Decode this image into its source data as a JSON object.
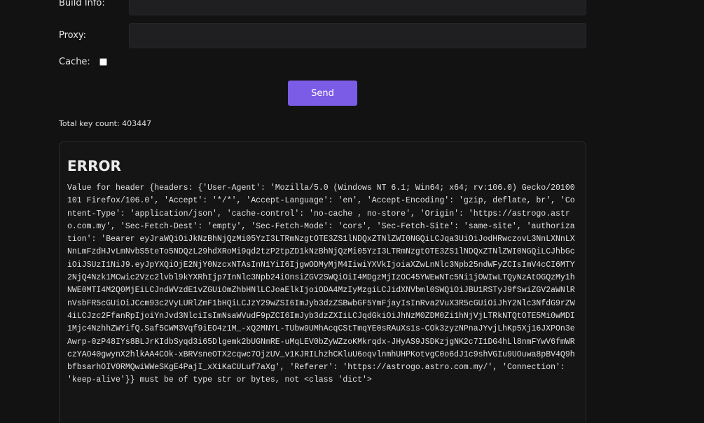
{
  "form": {
    "build_info_label": "Build Info:",
    "build_info_value": "",
    "proxy_label": "Proxy:",
    "proxy_value": "",
    "cache_label": "Cache:",
    "send_label": "Send"
  },
  "stats": {
    "key_count_text": "Total key count: 403447"
  },
  "result": {
    "title": "ERROR",
    "message": "Value for header {headers: {'User-Agent': 'Mozilla/5.0 (Windows NT 6.1; Win64; x64; rv:106.0) Gecko/20100101 Firefox/106.0', 'Accept': '*/*', 'Accept-Language': 'en', 'Accept-Encoding': 'gzip, deflate, br', 'Content-Type': 'application/json', 'cache-control': 'no-cache , no-store', 'Origin': 'https://astrogo.astro.com.my', 'Sec-Fetch-Dest': 'empty', 'Sec-Fetch-Mode': 'cors', 'Sec-Fetch-Site': 'same-site', 'authorization': 'Bearer eyJraWQiOiJkNzBhNjQzMi05YzI3LTRmNzgtOTE3ZS1lNDQxZTNlZWI0NGQiLCJqa3UiOiJodHRwczovL3NnLXNnLXNnLmFzdHJvLmNvbS5teTo5NDQzL29hdXRoMi9qd2tzP2tpZD1kNzBhNjQzMi05YzI3LTRmNzgtOTE3ZS1lNDQxZTNlZWI0NGQiLCJhbGciOiJSUzI1NiJ9.eyJpYXQiOjE2NjY0NzcxNTAsInN1YiI6IjgwODMyMjM4IiwiYXVkIjoiaXZwLnNlc3Npb25ndWFyZCIsImV4cCI6MTY2NjQ4Nzk1MCwic2Vzc2lvbl9kYXRhIjp7InNlc3Npb24iOnsiZGV2SWQiOiI4MDgzMjIzOC45YWEwNTc5Ni1jOWIwLTQyNzAtOGQzMy1hNWE0MTI4M2Q0MjEiLCJndWVzdE1vZGUiOmZhbHNlLCJoaElkIjoiODA4MzIyMzgiLCJidXNVbml0SWQiOiJBU1RSTyJ9fSwiZGV2aWNlRnVsbFR5cGUiOiJCcm93c2VyLURlZmF1bHQiLCJzY29wZSI6ImJyb3dzZSBwbGF5YmFjayIsInRva2VuX3R5cGUiOiJhY2Nlc3NfdG9rZW4iLCJzc2FfanRpIjoiYnJvd3NlciIsImNsaWVudF9pZCI6ImJyb3dzZXIiLCJqdGkiOiJhNzM0ZDM0Zi1hNjVjLTRkNTQtOTE5Mi0wMDI1Mjc4NzhhZWYifQ.Saf5CWM3Vqf9iEO4z1M_-xQ2MNYL-TUbw9UMhAcqCStTmqYE0sRAuXs1s-COk3zyzNPnaJYvjLhKp5Xj16JXPOn3eAwrp-0zP48IYs8BLJrKIdbSyqd3i65Dlgemk2bUGNmRE-uMqLEV0bZyWZzoKMkrqdx-JHyAS9JSDKzjgNK2c7I1DG4hLl8nmFYwV6fmWRczYAO40gwynX2hlkAA4COk-xBRVsneOTX2cqwc7OjzUV_v1KJRILhzhCKluU6oqvlnmhUHPKotvgC0o6dJ1c9shVGIu9UOuwa8pBV4Q9hbfbsarhOIV0RMQwiWWeSKgE4PajI_xXiKaCULuf7aXg', 'Referer': 'https://astrogo.astro.com.my/', 'Connection': 'keep-alive'}} must be of type str or bytes, not <class 'dict'>"
  }
}
